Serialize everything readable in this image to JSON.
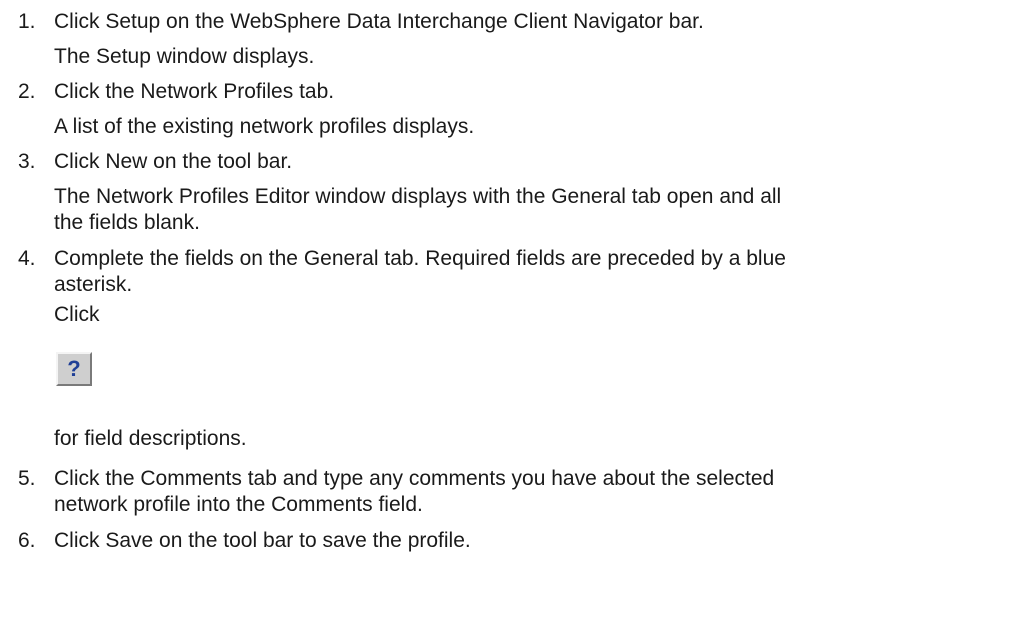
{
  "steps": [
    {
      "number": "1.",
      "lines": [
        "Click Setup on the WebSphere Data Interchange Client Navigator bar.",
        "The Setup window displays."
      ]
    },
    {
      "number": "2.",
      "lines": [
        "Click the Network Profiles tab.",
        "A list of the existing network profiles displays."
      ]
    },
    {
      "number": "3.",
      "lines": [
        "Click New on the tool bar.",
        "The Network Profiles Editor window displays with the General tab open and all",
        "the fields blank."
      ]
    },
    {
      "number": "4.",
      "lines": [
        "Complete the fields on the General tab. Required fields are preceded by a blue",
        "asterisk.",
        "Click",
        "for field descriptions."
      ],
      "help_icon": {
        "icon": "question-mark-help-icon",
        "glyph": "?",
        "color": "#1f3f96"
      }
    },
    {
      "number": "5.",
      "lines": [
        "Click the Comments tab and type any comments you have about the selected",
        "network profile into the Comments field."
      ]
    },
    {
      "number": "6.",
      "lines": [
        "Click Save on the tool bar to save the profile."
      ]
    }
  ]
}
